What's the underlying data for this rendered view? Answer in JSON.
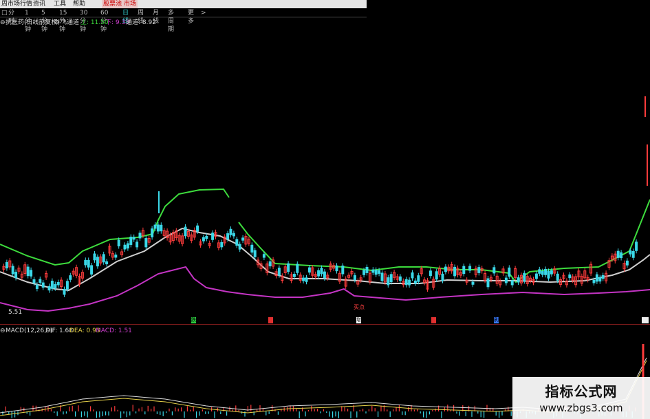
{
  "menu": {
    "market": "周市场行情",
    "info": "资讯",
    "tools": "工具",
    "help": "帮助",
    "stock_pick": "股票池",
    "market_tab": "市场"
  },
  "periods": [
    "分时",
    "1分钟",
    "5分钟",
    "15分钟",
    "30分钟",
    "60分钟",
    "日线",
    "周线",
    "月线",
    "多周期",
    "更多"
  ],
  "active_period": "日线",
  "info": {
    "stock": "抗医药(日线前复权)",
    "indicator": "飞通道",
    "upper_label": "上: 11.50",
    "lower_label": "下: 9.33",
    "channel_label": "通道: 8.92"
  },
  "price_label": "5.51",
  "signals": [
    "跌",
    "",
    "增",
    "",
    "刷"
  ],
  "signal_colors": [
    "#2ecc40",
    "#e03030",
    "#ffffff",
    "#e03030",
    "#3a7bff"
  ],
  "buy_label": "买点",
  "macd": {
    "name": "MACD(12,26,9)",
    "dif": "DIF: 1.68",
    "dea": "DEA: 0.93",
    "macd": "MACD: 1.51"
  },
  "watermark": {
    "title": "指标公式网",
    "url": "www.zbgs3.com"
  },
  "colors": {
    "up": "#ff3c3c",
    "down": "#3bd8e8",
    "upper_band": "#3ddc3d",
    "mid_band": "#cfcfcf",
    "lower_band": "#c434c4",
    "dea": "#e8d34a"
  }
}
